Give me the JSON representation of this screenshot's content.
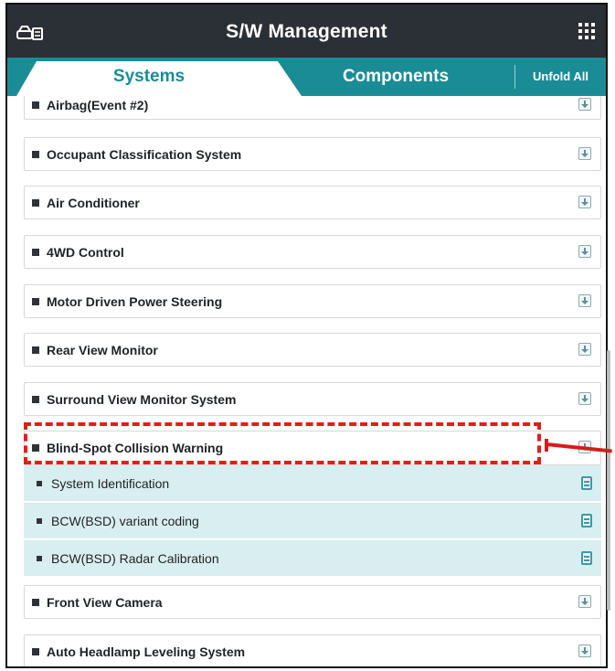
{
  "header": {
    "title": "S/W Management",
    "left_icon": "car-diagnostic-icon",
    "right_icon": "grid-menu-icon"
  },
  "tabs": [
    {
      "label": "Systems",
      "active": true
    },
    {
      "label": "Components",
      "active": false
    }
  ],
  "unfold_label": "Unfold All",
  "systems": [
    {
      "label": "Airbag(Event #2)"
    },
    {
      "label": "Occupant Classification System"
    },
    {
      "label": "Air Conditioner"
    },
    {
      "label": "4WD Control"
    },
    {
      "label": "Motor Driven Power Steering"
    },
    {
      "label": "Rear View Monitor"
    },
    {
      "label": "Surround View Monitor System"
    },
    {
      "label": "Blind-Spot Collision Warning",
      "expanded": true
    },
    {
      "label": "Front View Camera"
    },
    {
      "label": "Auto Headlamp Leveling System"
    }
  ],
  "sub_items": [
    {
      "label": "System Identification"
    },
    {
      "label": "BCW(BSD) variant coding"
    },
    {
      "label": "BCW(BSD) Radar Calibration"
    }
  ],
  "colors": {
    "header_bg": "#2a3036",
    "tab_teal": "#1a8c96",
    "sub_bg": "#d9eef0",
    "annotation_red": "#e81b1b"
  }
}
